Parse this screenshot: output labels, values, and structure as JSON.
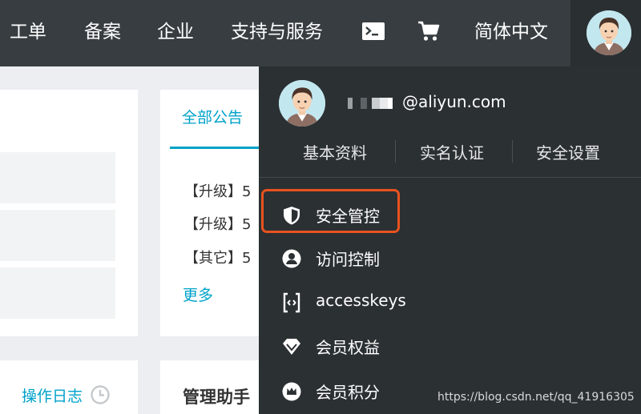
{
  "topnav": {
    "items": [
      "工单",
      "备案",
      "企业",
      "支持与服务",
      "简体中文"
    ],
    "icons": [
      "terminal-icon",
      "cart-icon"
    ]
  },
  "background": {
    "notice_tab": "全部公告",
    "notices": [
      "【升级】5",
      "【升级】5",
      "【其它】5"
    ],
    "more": "更多",
    "operation_log": "操作日志",
    "helper_title": "管理助手"
  },
  "account_menu": {
    "email_visible": "@aliyun.com",
    "quick_links": [
      "基本资料",
      "实名认证",
      "安全设置"
    ],
    "items": [
      {
        "label": "安全管控",
        "icon": "shield-icon",
        "highlighted": true
      },
      {
        "label": "访问控制",
        "icon": "user-circle-icon"
      },
      {
        "label": "accesskeys",
        "icon": "code-brackets-icon"
      },
      {
        "label": "会员权益",
        "icon": "diamond-icon"
      },
      {
        "label": "会员积分",
        "icon": "crown-icon"
      }
    ]
  },
  "colors": {
    "topbar": "#373d41",
    "dropdown": "#2b3033",
    "accent": "#00a2ca",
    "highlight_border": "#e8531f"
  },
  "watermark": "https://blog.csdn.net/qq_41916305"
}
